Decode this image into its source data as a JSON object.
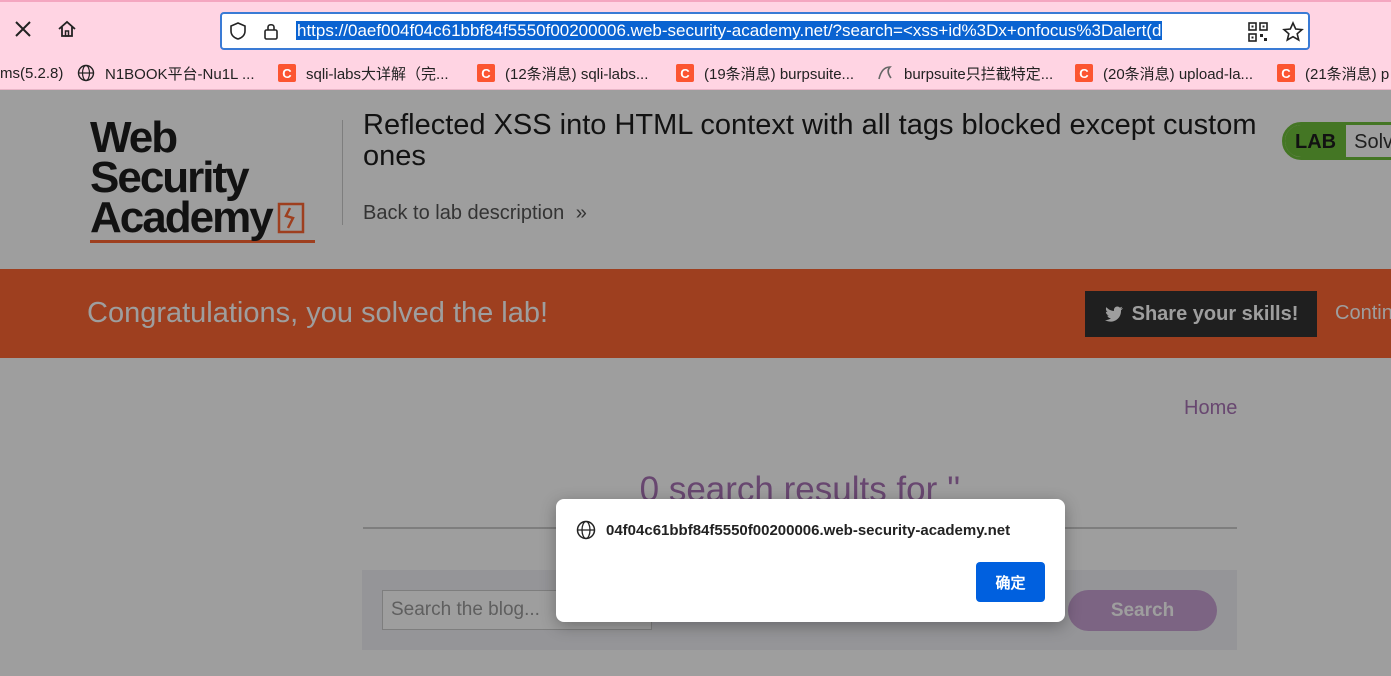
{
  "browser": {
    "url": "https://0aef004f04c61bbf84f5550f00200006.web-security-academy.net/?search=<xss+id%3Dx+onfocus%3Dalert(d"
  },
  "bookmarks": [
    {
      "label": "ms(5.2.8)",
      "icon": "none"
    },
    {
      "label": "N1BOOK平台-Nu1L ...",
      "icon": "globe-icon"
    },
    {
      "label": "sqli-labs大详解（完...",
      "icon": "csdn-icon"
    },
    {
      "label": "(12条消息) sqli-labs...",
      "icon": "csdn-icon"
    },
    {
      "label": "(19条消息) burpsuite...",
      "icon": "csdn-icon"
    },
    {
      "label": "burpsuite只拦截特定...",
      "icon": "burp-icon"
    },
    {
      "label": "(20条消息) upload-la...",
      "icon": "csdn-icon"
    },
    {
      "label": "(21条消息) p",
      "icon": "csdn-icon"
    }
  ],
  "header": {
    "logo_line1": "Web Security",
    "logo_line2": "Academy",
    "lab_title": "Reflected XSS into HTML context with all tags blocked except custom ones",
    "back_link": "Back to lab description",
    "badge_left": "LAB",
    "badge_right": "Solv"
  },
  "banner": {
    "text": "Congratulations, you solved the lab!",
    "share": "Share your skills!",
    "continue": "Contin"
  },
  "main": {
    "home": "Home",
    "results": "0 search results for ''",
    "search_placeholder": "Search the blog...",
    "search_button": "Search"
  },
  "dialog": {
    "origin": "04f04c61bbf84f5550f00200006.web-security-academy.net",
    "ok": "确定"
  }
}
